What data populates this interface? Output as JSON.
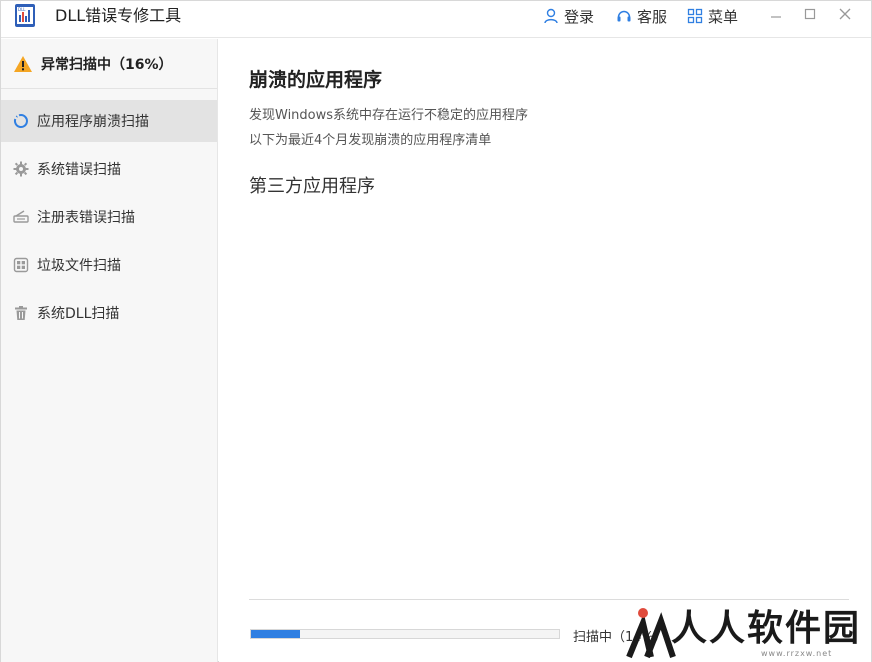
{
  "app": {
    "title": "DLL错误专修工具"
  },
  "titlebar": {
    "login_label": "登录",
    "service_label": "客服",
    "menu_label": "菜单"
  },
  "sidebar": {
    "status": {
      "label": "异常扫描中（16%）"
    },
    "items": [
      {
        "label": "应用程序崩溃扫描",
        "icon": "refresh-icon",
        "active": true
      },
      {
        "label": "系统错误扫描",
        "icon": "gear-icon",
        "active": false
      },
      {
        "label": "注册表错误扫描",
        "icon": "scanner-icon",
        "active": false
      },
      {
        "label": "垃圾文件扫描",
        "icon": "grid-box-icon",
        "active": false
      },
      {
        "label": "系统DLL扫描",
        "icon": "trash-icon",
        "active": false
      }
    ]
  },
  "main": {
    "title": "崩溃的应用程序",
    "description_1": "发现Windows系统中存在运行不稳定的应用程序",
    "description_2": "以下为最近4个月发现崩溃的应用程序清单",
    "section_title": "第三方应用程序",
    "progress": {
      "fraction": 0.16,
      "label": "扫描中（14%）"
    }
  },
  "watermark": {
    "text": "人人软件园",
    "url": "www.rrzxw.net"
  },
  "colors": {
    "accent": "#2f7fe2",
    "warning": "#f5a623",
    "active_bg": "#e3e3e3",
    "sidebar_bg": "#f7f7f7"
  }
}
